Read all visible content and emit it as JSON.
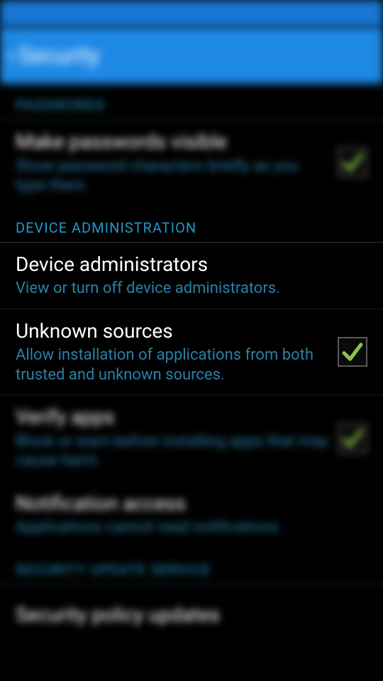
{
  "header": {
    "back_glyph": "‹",
    "title": "Security"
  },
  "sections": {
    "passwords": {
      "label": "PASSWORDS",
      "make_visible": {
        "title": "Make passwords visible",
        "subtitle": "Show password characters briefly as you type them.",
        "checked": true
      }
    },
    "device_admin": {
      "label": "DEVICE ADMINISTRATION",
      "administrators": {
        "title": "Device administrators",
        "subtitle": "View or turn off device administrators."
      },
      "unknown_sources": {
        "title": "Unknown sources",
        "subtitle": "Allow installation of applications from both trusted and unknown sources.",
        "checked": true
      },
      "verify_apps": {
        "title": "Verify apps",
        "subtitle": "Block or warn before installing apps that may cause harm.",
        "checked": true
      },
      "notification_access": {
        "title": "Notification access",
        "subtitle": "Applications cannot read notifications."
      }
    },
    "security_update": {
      "label": "SECURITY UPDATE SERVICE",
      "policy_updates": {
        "title": "Security policy updates",
        "subtitle": ""
      }
    }
  }
}
